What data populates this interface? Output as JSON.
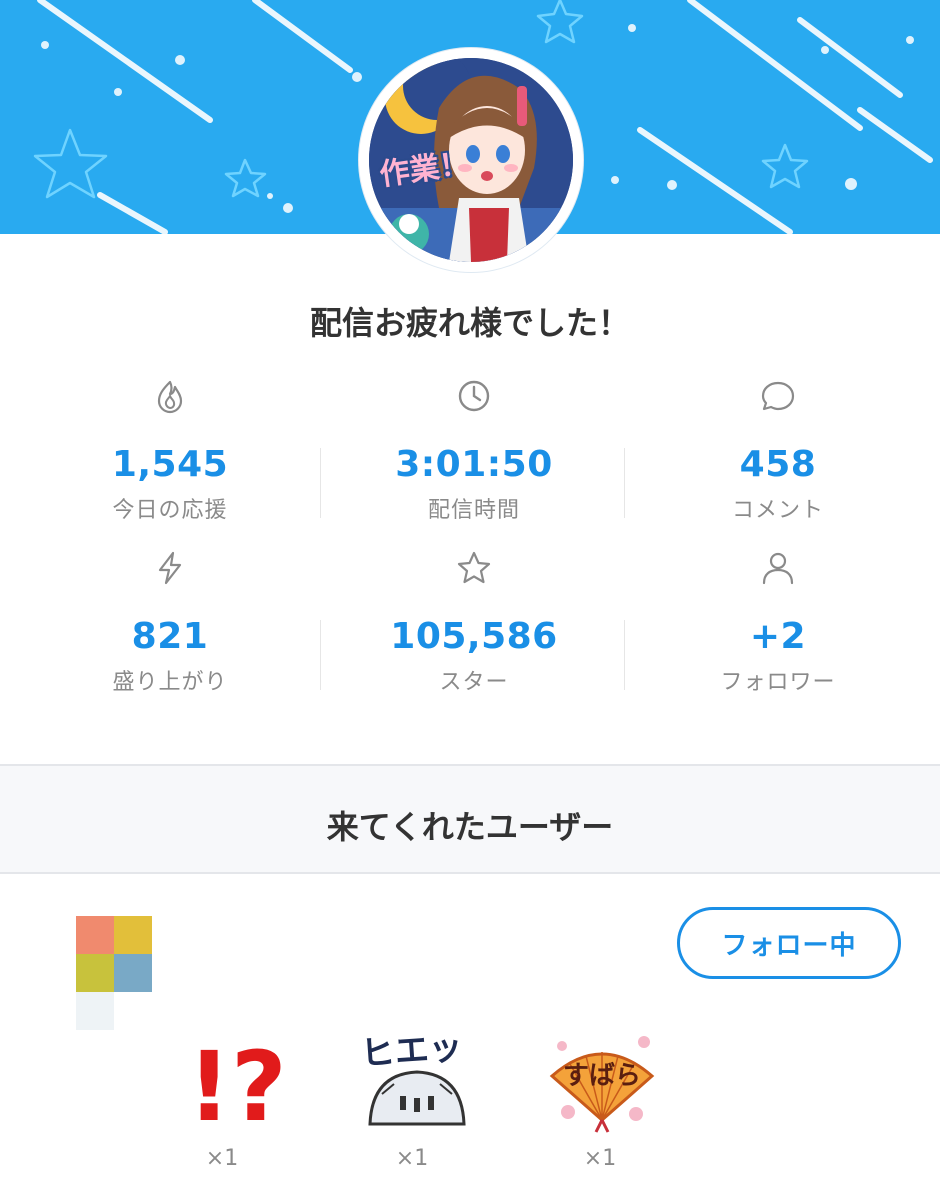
{
  "avatar": {
    "stamp_text": "作業！"
  },
  "summary": {
    "title": "配信お疲れ様でした！"
  },
  "stats": [
    {
      "icon": "flame-icon",
      "value": "1,545",
      "label": "今日の応援"
    },
    {
      "icon": "clock-icon",
      "value": "3:01:50",
      "label": "配信時間"
    },
    {
      "icon": "comment-icon",
      "value": "458",
      "label": "コメント"
    },
    {
      "icon": "lightning-icon",
      "value": "821",
      "label": "盛り上がり"
    },
    {
      "icon": "star-icon",
      "value": "105,586",
      "label": "スター"
    },
    {
      "icon": "person-icon",
      "value": "+2",
      "label": "フォロワー"
    }
  ],
  "visitors": {
    "title": "来てくれたユーザー",
    "follow_button": "フォロー中",
    "stickers": [
      {
        "name": "exclaim-question-sticker",
        "text": "!?",
        "count": "×1"
      },
      {
        "name": "hyeh-sticker",
        "text": "ヒエッ",
        "count": "×1"
      },
      {
        "name": "subara-sticker",
        "text": "すばら",
        "count": "×1"
      }
    ]
  },
  "colors": {
    "banner": "#29aaf0",
    "accent": "#1a8fe6",
    "label": "#8a8a8a"
  }
}
